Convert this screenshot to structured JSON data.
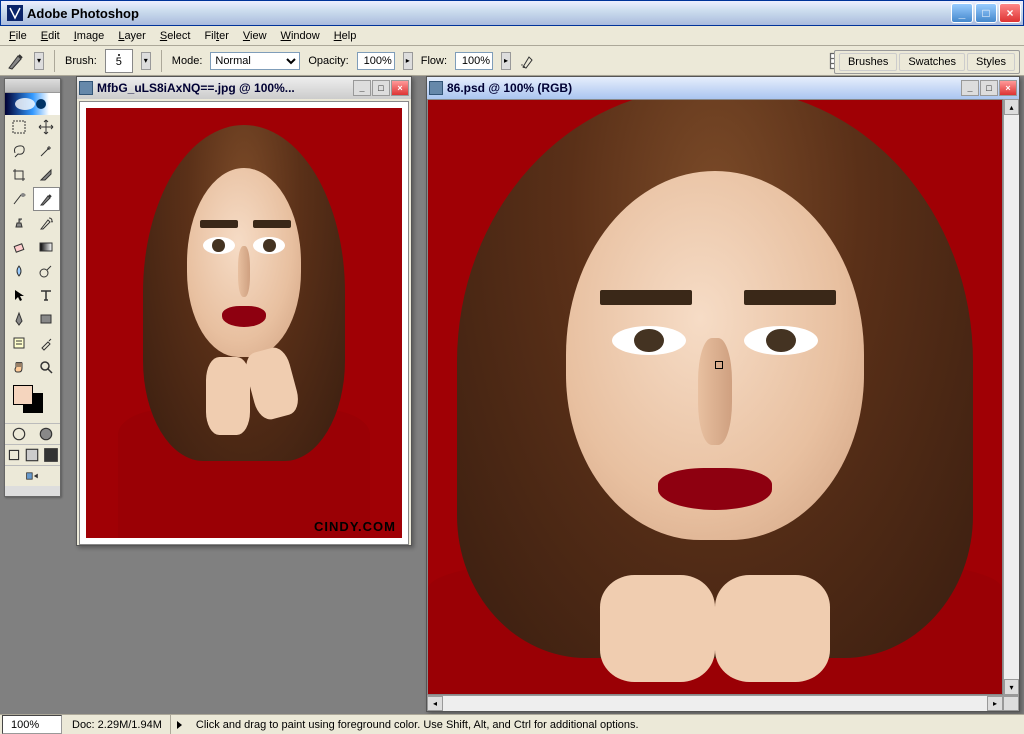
{
  "app": {
    "title": "Adobe Photoshop"
  },
  "menu": {
    "items": [
      "File",
      "Edit",
      "Image",
      "Layer",
      "Select",
      "Filter",
      "View",
      "Window",
      "Help"
    ]
  },
  "options": {
    "brush_label": "Brush:",
    "brush_size": "5",
    "mode_label": "Mode:",
    "mode_value": "Normal",
    "opacity_label": "Opacity:",
    "opacity_value": "100%",
    "flow_label": "Flow:",
    "flow_value": "100%"
  },
  "palettes": {
    "tabs": [
      "Brushes",
      "Swatches",
      "Styles"
    ]
  },
  "toolbox": {
    "tools": [
      "rectangular-marquee",
      "move",
      "lasso",
      "magic-wand",
      "crop",
      "slice",
      "healing-brush",
      "brush",
      "clone-stamp",
      "history-brush",
      "eraser",
      "gradient",
      "blur",
      "dodge",
      "path-selection",
      "type",
      "pen",
      "rectangle",
      "notes",
      "eyedropper",
      "hand",
      "zoom"
    ],
    "selected": "brush",
    "fg_color": "#f5d5be",
    "bg_color": "#000000",
    "mode_buttons": [
      "standard-mode",
      "quickmask-mode"
    ],
    "screen_buttons": [
      "standard-screen",
      "full-menubar",
      "full-screen"
    ],
    "jump_button": "jump-to-imageready"
  },
  "documents": [
    {
      "title": "MfbG_uLS8iAxNQ==.jpg @ 100%...",
      "active": false,
      "watermark": "CINDY.COM"
    },
    {
      "title": "86.psd @ 100% (RGB)",
      "active": true,
      "watermark": ""
    }
  ],
  "status": {
    "zoom": "100%",
    "doc_size": "Doc: 2.29M/1.94M",
    "hint": "Click and drag to paint using foreground color. Use Shift, Alt, and Ctrl for additional options."
  }
}
